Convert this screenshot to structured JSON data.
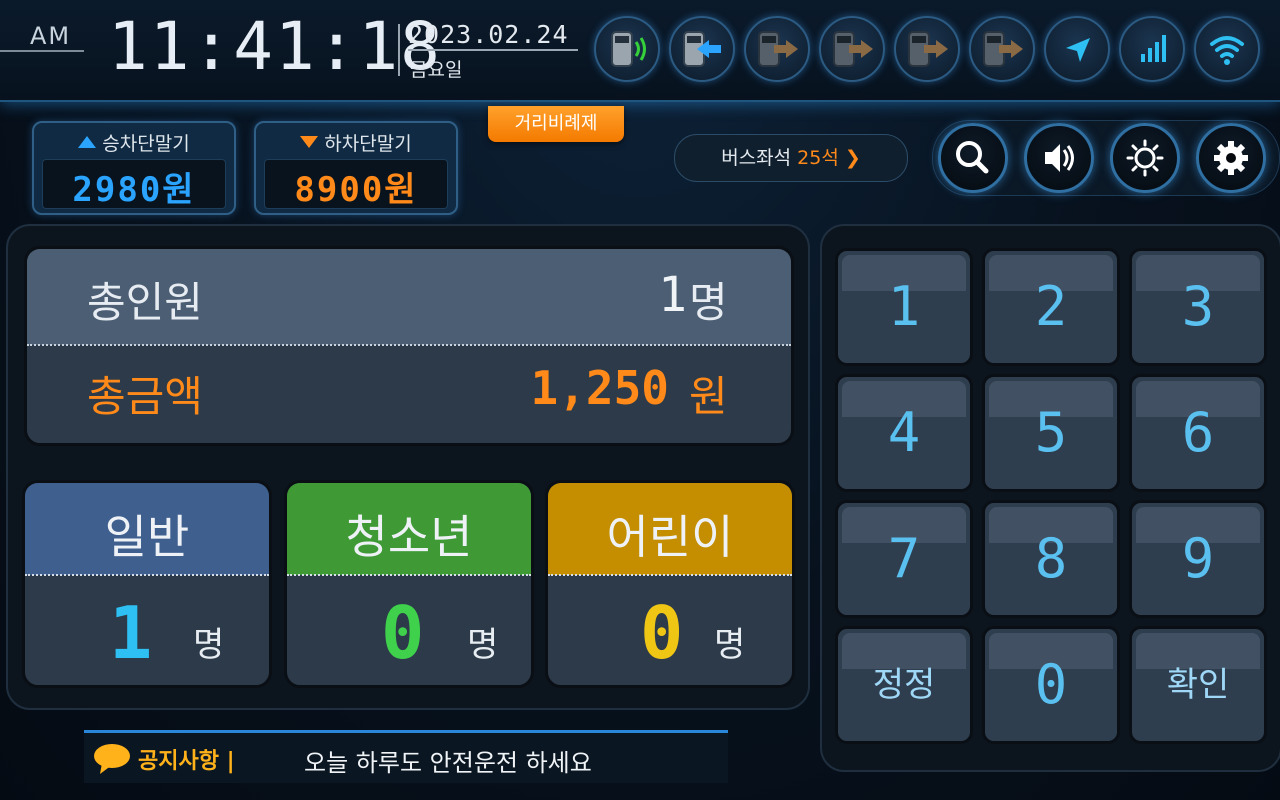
{
  "header": {
    "ampm": "AM",
    "time": "11:41:18",
    "date": "2023.02.24",
    "weekday": "금요일",
    "status_icons": [
      {
        "name": "card-reader-tap-icon",
        "state": "active"
      },
      {
        "name": "terminal-incoming-icon",
        "state": "active"
      },
      {
        "name": "terminal-outgoing-icon",
        "state": "inactive"
      },
      {
        "name": "terminal-outgoing-icon",
        "state": "inactive"
      },
      {
        "name": "terminal-outgoing-icon",
        "state": "inactive"
      },
      {
        "name": "terminal-outgoing-icon",
        "state": "inactive"
      },
      {
        "name": "gps-icon",
        "state": "active"
      },
      {
        "name": "signal-bars-icon",
        "state": "active"
      },
      {
        "name": "wifi-icon",
        "state": "active"
      }
    ]
  },
  "fares": {
    "boarding": {
      "label": "승차단말기",
      "amount": "2980원",
      "color": "#2aa4ff"
    },
    "alighting": {
      "label": "하차단말기",
      "amount": "8900원",
      "color": "#ff8a1a"
    }
  },
  "distance_tag": "거리비례제",
  "seats": {
    "label": "버스좌석",
    "value": "25석",
    "arrow": "❯"
  },
  "controls": [
    "search-icon",
    "volume-icon",
    "brightness-icon",
    "settings-gear-icon"
  ],
  "totals": {
    "people_label": "총인원",
    "people_value": "1",
    "people_unit": "명",
    "amount_label": "총금액",
    "amount_value": "1,250",
    "amount_unit": "원"
  },
  "passengers": [
    {
      "type": "일반",
      "count": "1",
      "unit": "명",
      "header_color": "#3f5f8e",
      "count_color": "#2ec0f2"
    },
    {
      "type": "청소년",
      "count": "0",
      "unit": "명",
      "header_color": "#3f9a36",
      "count_color": "#3fd04c"
    },
    {
      "type": "어린이",
      "count": "0",
      "unit": "명",
      "header_color": "#c48e00",
      "count_color": "#f0c615"
    }
  ],
  "keypad": [
    "1",
    "2",
    "3",
    "4",
    "5",
    "6",
    "7",
    "8",
    "9",
    "정정",
    "0",
    "확인"
  ],
  "notice": {
    "title": "공지사항 |",
    "message": "오늘 하루도 안전운전 하세요"
  },
  "colors": {
    "accent_blue": "#2aa4ff",
    "accent_orange": "#ff8a1a",
    "keypad_digit": "#5ac0f0"
  }
}
